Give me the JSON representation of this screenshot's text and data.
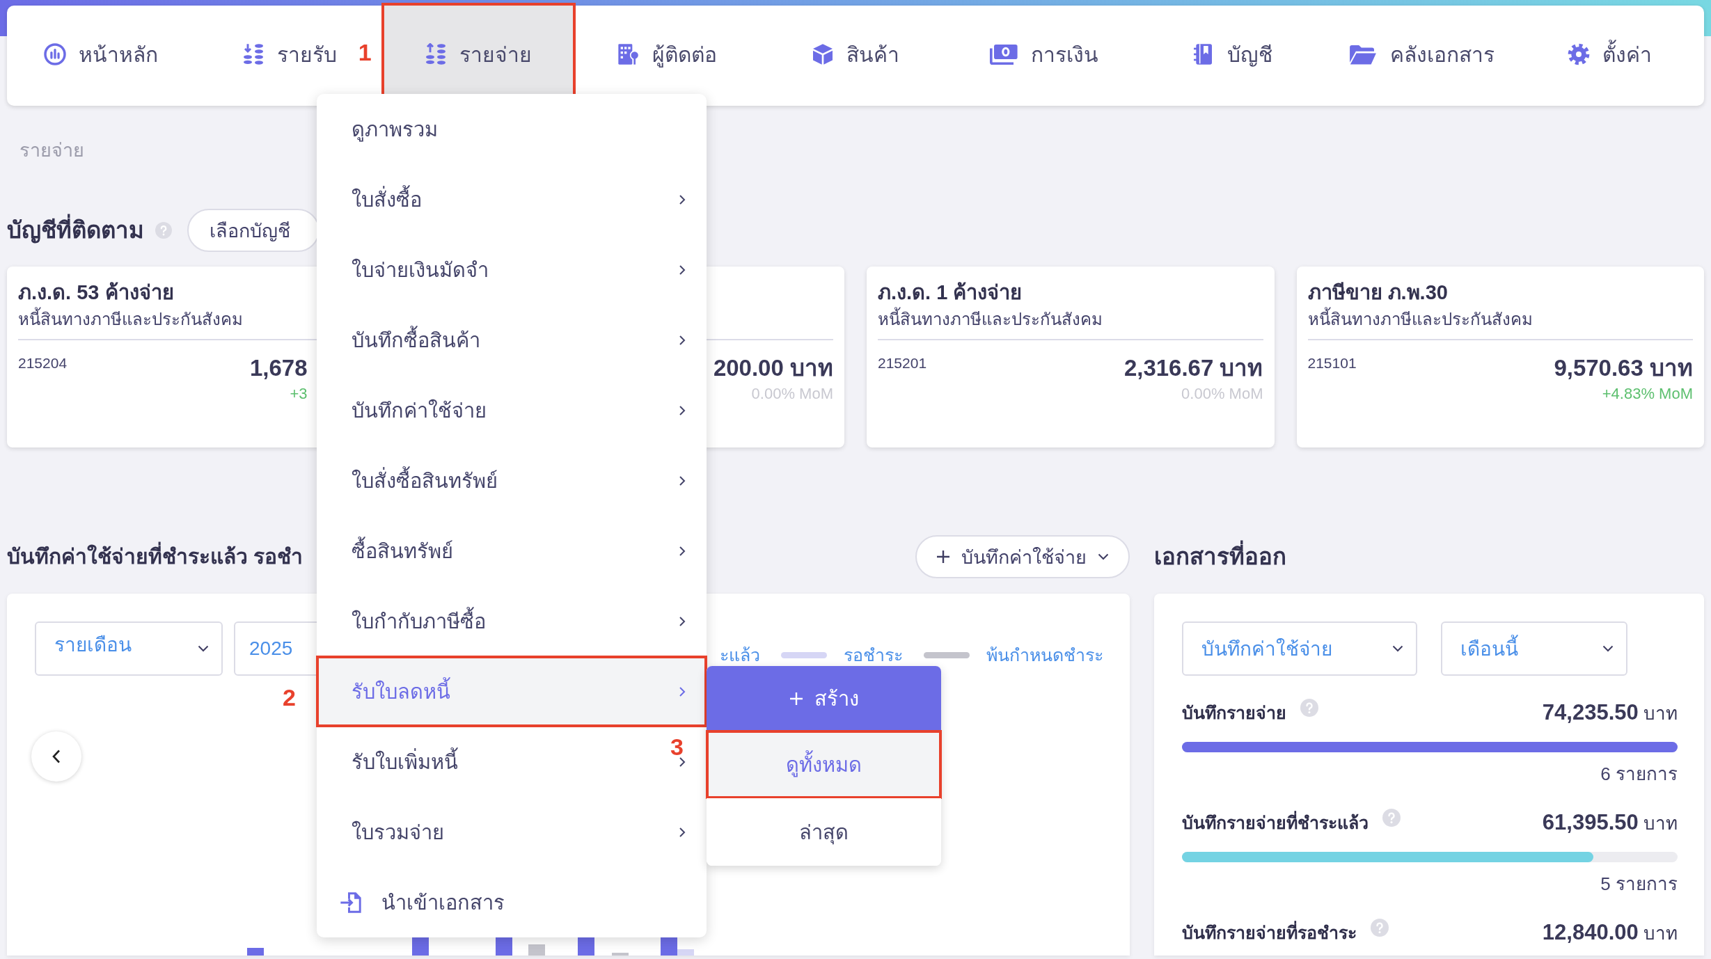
{
  "nav": [
    {
      "kind": "home",
      "label": "หน้าหลัก",
      "selected": false
    },
    {
      "kind": "income",
      "label": "รายรับ",
      "selected": false
    },
    {
      "kind": "expense",
      "label": "รายจ่าย",
      "selected": true,
      "callout": "1"
    },
    {
      "kind": "contacts",
      "label": "ผู้ติดต่อ",
      "selected": false
    },
    {
      "kind": "products",
      "label": "สินค้า",
      "selected": false
    },
    {
      "kind": "finance",
      "label": "การเงิน",
      "selected": false
    },
    {
      "kind": "accounts",
      "label": "บัญชี",
      "selected": false
    },
    {
      "kind": "documents",
      "label": "คลังเอกสาร",
      "selected": false
    },
    {
      "kind": "settings",
      "label": "ตั้งค่า",
      "selected": false
    }
  ],
  "breadcrumb": "รายจ่าย",
  "watched_accounts": {
    "title": "บัญชีที่ติดตาม",
    "select_button": "เลือกบัญชี",
    "cards": [
      {
        "cut_off": true,
        "title": "ภ.ง.ด. 53 ค้างจ่าย",
        "subtitle": "หนี้สินทางภาษีและประกันสังคม",
        "code": "215204",
        "amount": "1,678",
        "change": "+3",
        "rising": true
      },
      {
        "amount": "200.00 บาท",
        "change": "0.00% MoM",
        "rising": false
      },
      {
        "title": "ภ.ง.ด. 1 ค้างจ่าย",
        "subtitle": "หนี้สินทางภาษีและประกันสังคม",
        "code": "215201",
        "amount": "2,316.67 บาท",
        "change": "0.00% MoM",
        "rising": false
      },
      {
        "title": "ภาษีขาย ภ.พ.30",
        "subtitle": "หนี้สินทางภาษีและประกันสังคม",
        "code": "215101",
        "amount": "9,570.63 บาท",
        "change": "+4.83% MoM",
        "rising": true
      }
    ]
  },
  "expense_section": {
    "title": "บันทึกค่าใช้จ่ายที่ชำระแล้ว รอชำ",
    "add_button": "บันทึกค่าใช้จ่าย",
    "period": "รายเดือน",
    "year": "2025",
    "legend": [
      {
        "label": "ะแล้ว"
      },
      {
        "label": "รอชำระ",
        "color": "#d6d6f5"
      },
      {
        "label": "พ้นกำหนดชำระ",
        "color": "#c4c4cc"
      }
    ]
  },
  "issued_documents": {
    "title": "เอกสารที่ออก",
    "type_filter": "บันทึกค่าใช้จ่าย",
    "period_filter": "เดือนนี้",
    "rows": [
      {
        "label": "บันทึกรายจ่าย",
        "amount": "74,235.50",
        "unit": "บาท",
        "level": 1,
        "count": "6 รายการ",
        "color": "#6c6ce6"
      },
      {
        "label": "บันทึกรายจ่ายที่ชำระแล้ว",
        "amount": "61,395.50",
        "unit": "บาท",
        "level": 0.83,
        "count": "5 รายการ",
        "color": "#74d3e3"
      },
      {
        "label": "บันทึกรายจ่ายที่รอชำระ",
        "amount": "12,840.00",
        "unit": "บาท"
      }
    ]
  },
  "expense_menu": {
    "items": [
      {
        "kind": "link",
        "label": "ดูภาพรวม",
        "selected": false
      },
      {
        "kind": "submenu",
        "label": "ใบสั่งซื้อ",
        "selected": false
      },
      {
        "kind": "submenu",
        "label": "ใบจ่ายเงินมัดจำ",
        "selected": false
      },
      {
        "kind": "submenu",
        "label": "บันทึกซื้อสินค้า",
        "selected": false
      },
      {
        "kind": "submenu",
        "label": "บันทึกค่าใช้จ่าย",
        "selected": false
      },
      {
        "kind": "submenu",
        "label": "ใบสั่งซื้อสินทรัพย์",
        "selected": false
      },
      {
        "kind": "submenu",
        "label": "ซื้อสินทรัพย์",
        "selected": false
      },
      {
        "kind": "submenu",
        "label": "ใบกำกับภาษีซื้อ",
        "selected": false
      },
      {
        "kind": "submenu",
        "label": "รับใบลดหนี้",
        "selected": true,
        "callout": "2",
        "submenu": [
          {
            "kind": "create",
            "label": "สร้าง",
            "selected": false
          },
          {
            "kind": "link",
            "label": "ดูทั้งหมด",
            "selected": true,
            "callout": "3"
          },
          {
            "kind": "link",
            "label": "ล่าสุด",
            "selected": false
          }
        ]
      },
      {
        "kind": "submenu",
        "label": "รับใบเพิ่มหนี้",
        "selected": false
      },
      {
        "kind": "submenu",
        "label": "ใบรวมจ่าย",
        "selected": false
      },
      {
        "kind": "import",
        "label": "นำเข้าเอกสาร",
        "selected": false
      }
    ]
  }
}
